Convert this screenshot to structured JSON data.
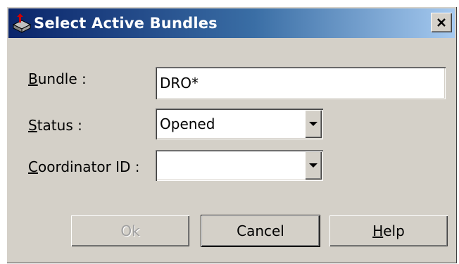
{
  "window": {
    "title": "Select Active Bundles",
    "close_symbol": "✕"
  },
  "form": {
    "bundle": {
      "label_accel": "B",
      "label_rest": "undle :",
      "value": "DRO*"
    },
    "status": {
      "label_accel": "S",
      "label_rest": "tatus :",
      "value": "Opened"
    },
    "coordinator": {
      "label_accel": "C",
      "label_rest": "oordinator ID :",
      "value": ""
    }
  },
  "buttons": {
    "ok": {
      "label": "Ok",
      "enabled": false
    },
    "cancel": {
      "label": "Cancel"
    },
    "help": {
      "label_accel": "H",
      "label_rest": "elp"
    }
  },
  "colors": {
    "titlebar_start": "#0a246a",
    "titlebar_end": "#a6caf0",
    "face": "#d4d0c8"
  },
  "icons": {
    "app": "bundle-app-icon",
    "dropdown": "chevron-down-icon",
    "close": "close-icon"
  }
}
